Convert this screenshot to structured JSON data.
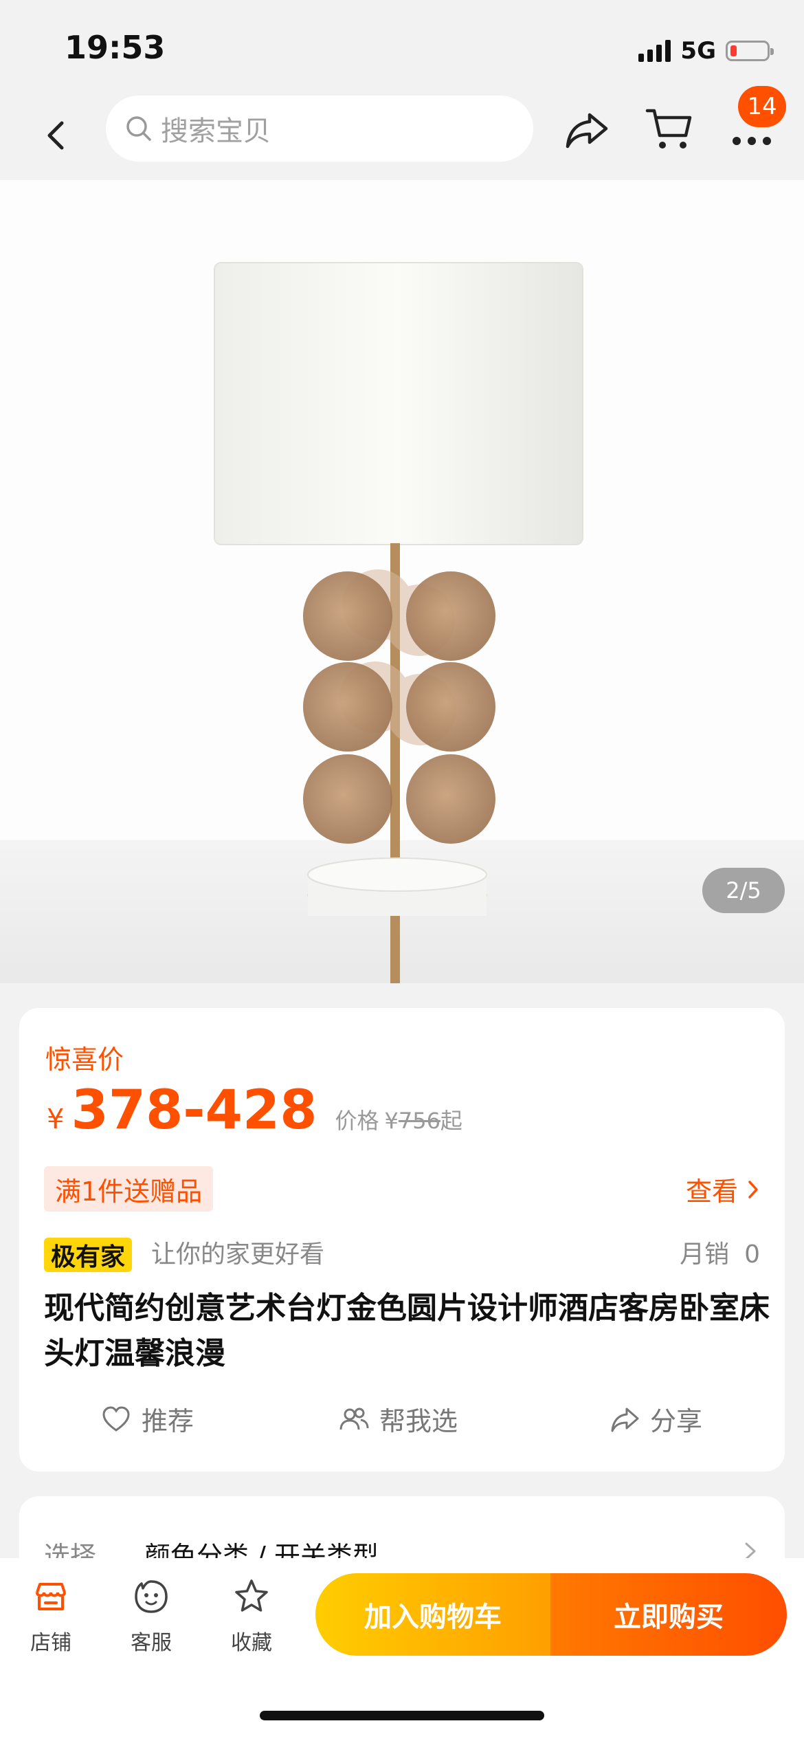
{
  "status": {
    "time": "19:53",
    "network": "5G"
  },
  "nav": {
    "search_placeholder": "搜索宝贝",
    "cart_badge": "14"
  },
  "gallery": {
    "page_indicator": "2/5"
  },
  "product": {
    "price_tag": "惊喜价",
    "currency": "¥",
    "price": "378-428",
    "orig_label": "价格",
    "orig_currency": "¥",
    "orig_price": "756",
    "orig_suffix": "起",
    "promo": "满1件送赠品",
    "view_label": "查看",
    "brand": "极有家",
    "brand_slogan": "让你的家更好看",
    "monthly_sales_label": "月销",
    "monthly_sales_value": "0",
    "title": "现代简约创意艺术台灯金色圆片设计师酒店客房卧室床头灯温馨浪漫"
  },
  "actions": {
    "recommend": "推荐",
    "help_choose": "帮我选",
    "share": "分享"
  },
  "selection": {
    "label": "选择",
    "value": "颜色分类 / 开关类型"
  },
  "bottom_bar": {
    "store": "店铺",
    "service": "客服",
    "favorite": "收藏",
    "add_to_cart": "加入购物车",
    "buy_now": "立即购买"
  },
  "colors": {
    "accent": "#ff5000",
    "brand_yellow": "#ffd60a"
  }
}
